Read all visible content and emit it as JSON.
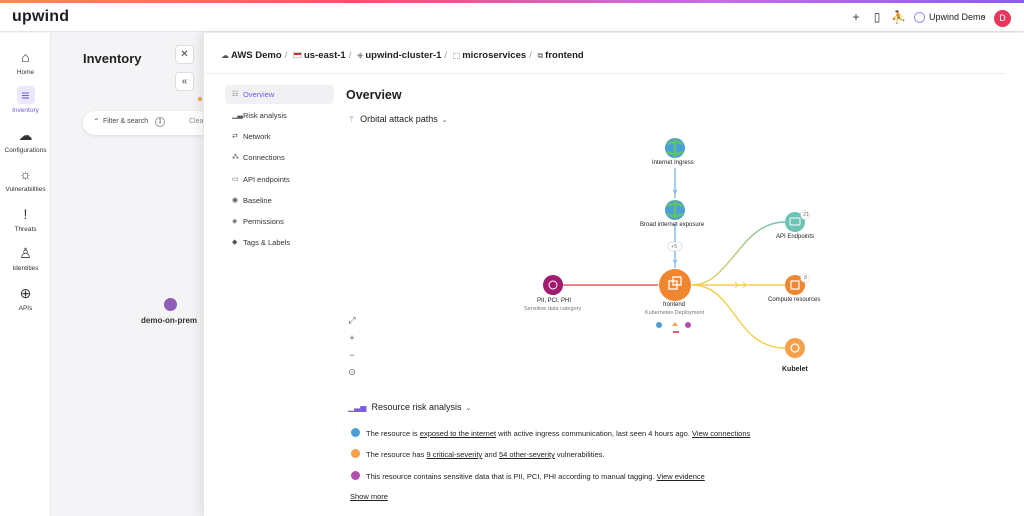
{
  "app": {
    "logo": "upwind"
  },
  "topbar": {
    "user_name": "Upwind Demo",
    "avatar_initial": "D"
  },
  "nav": [
    {
      "label": "Home",
      "icon": "home-icon"
    },
    {
      "label": "Inventory",
      "icon": "list-icon"
    },
    {
      "label": "Configurations",
      "icon": "cloud-icon"
    },
    {
      "label": "Vulnerabilities",
      "icon": "bug-icon"
    },
    {
      "label": "Threats",
      "icon": "alert-icon"
    },
    {
      "label": "Identities",
      "icon": "user-icon"
    },
    {
      "label": "APIs",
      "icon": "globe-icon"
    }
  ],
  "inventory": {
    "title": "Inventory",
    "filter_label": "Filter & search",
    "filter_count": "1",
    "clear_label": "Clea",
    "bg_node_label": "demo-on-prem"
  },
  "breadcrumb": [
    "AWS Demo",
    "us-east-1",
    "upwind-cluster-1",
    "microservices",
    "frontend"
  ],
  "tabs": [
    "Overview",
    "Risk analysis",
    "Network",
    "Connections",
    "API endpoints",
    "Baseline",
    "Permissions",
    "Tags & Labels"
  ],
  "overview": {
    "title": "Overview",
    "attack_paths_title": "Orbital attack paths",
    "risk_title": "Resource risk analysis",
    "show_more": "Show more"
  },
  "graph": {
    "internet_ingress": "Internet Ingress",
    "broad_exposure": "Broad internet exposure",
    "plus_badge": "+5",
    "pii_label": "PII, PCI, PHI",
    "pii_sub": "Sensitive data category",
    "center_label": "frontend",
    "center_sub": "Kubernetes Deployment",
    "api_endpoints": "API Endpoints",
    "api_count": "21",
    "compute": "Compute resources",
    "compute_count": "8",
    "kubelet": "Kubelet"
  },
  "risks": [
    {
      "a": "The resource is ",
      "link1": "exposed to the internet",
      "b": " with active ingress communication, last seen 4 hours ago. ",
      "link2": "View connections",
      "c": ""
    },
    {
      "a": "The resource has ",
      "link1": "9 critical-severity",
      "b": " and ",
      "link2": "54 other-severity",
      "c": " vulnerabilities."
    },
    {
      "a": "This resource contains sensitive data that is  PII, PCI, PHI  according to manual tagging.  ",
      "link1": "",
      "b": "",
      "link2": "View evidence",
      "c": ""
    }
  ],
  "colors": {
    "accent": "#6b5ce7",
    "orange": "#f0862f",
    "teal": "#6cc3b5",
    "yellow": "#f5cf4a",
    "red": "#e85a6b",
    "pii": "#a11a6e"
  }
}
